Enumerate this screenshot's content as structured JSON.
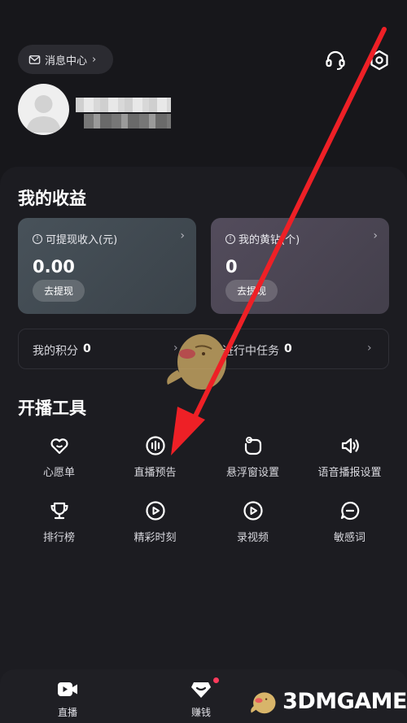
{
  "header": {
    "message_center_label": "消息中心",
    "icons": [
      "mail-icon",
      "chevron-right-icon",
      "headset-icon",
      "settings-icon"
    ]
  },
  "earnings": {
    "title": "我的收益",
    "withdrawable": {
      "label": "可提现收入(元)",
      "value": "0.00",
      "button": "去提现"
    },
    "yellow_diamond": {
      "label": "我的黄钻(个)",
      "value": "0",
      "button": "去提现"
    },
    "points_label": "我的积分",
    "points_value": "0",
    "tasks_label": "进行中任务",
    "tasks_value": "0"
  },
  "tools": {
    "title": "开播工具",
    "items": [
      {
        "label": "心愿单",
        "icon": "heart-icon"
      },
      {
        "label": "直播预告",
        "icon": "live-preview-icon"
      },
      {
        "label": "悬浮窗设置",
        "icon": "floating-window-icon"
      },
      {
        "label": "语音播报设置",
        "icon": "speaker-icon"
      },
      {
        "label": "排行榜",
        "icon": "trophy-icon"
      },
      {
        "label": "精彩时刻",
        "icon": "highlight-icon"
      },
      {
        "label": "录视频",
        "icon": "record-video-icon"
      },
      {
        "label": "敏感词",
        "icon": "chat-bubble-icon"
      }
    ]
  },
  "bottom_nav": {
    "live_label": "直播",
    "earn_label": "赚钱"
  },
  "watermark": {
    "text": "3DMGAME"
  },
  "colors": {
    "background": "#17171b",
    "panel": "#1c1c21",
    "card_left": "#3e474e",
    "card_right": "#4a4552",
    "annotation_arrow": "#ee2026",
    "badge_dot": "#ff3b5c"
  }
}
